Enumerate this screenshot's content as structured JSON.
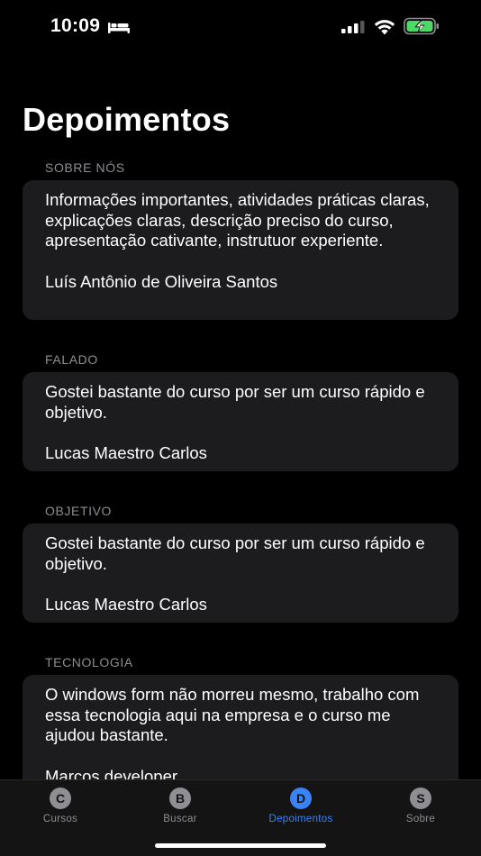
{
  "status": {
    "time": "10:09"
  },
  "title": "Depoimentos",
  "sections": [
    {
      "header": "SOBRE NÓS",
      "text": "Informações importantes, atividades práticas claras, explicações claras, descrição preciso do curso, apresentação cativante, instrutuor experiente.",
      "author": "Luís Antônio de Oliveira Santos"
    },
    {
      "header": "FALADO",
      "text": "Gostei bastante do curso por ser um curso rápido e objetivo.",
      "author": "Lucas Maestro Carlos"
    },
    {
      "header": "OBJETIVO",
      "text": "Gostei bastante do curso por ser um curso rápido e objetivo.",
      "author": "Lucas Maestro Carlos"
    },
    {
      "header": "TECNOLOGIA",
      "text": "O windows form não morreu mesmo, trabalho com essa tecnologia aqui na empresa e o curso me ajudou bastante.",
      "author": "Marcos developer"
    }
  ],
  "tabs": [
    {
      "letter": "C",
      "label": "Cursos"
    },
    {
      "letter": "B",
      "label": "Buscar"
    },
    {
      "letter": "D",
      "label": "Depoimentos"
    },
    {
      "letter": "S",
      "label": "Sobre"
    }
  ],
  "colors": {
    "accent": "#3a82f7",
    "card": "#1c1c1e",
    "secondary": "#8e8e93",
    "battery": "#4cd964"
  }
}
